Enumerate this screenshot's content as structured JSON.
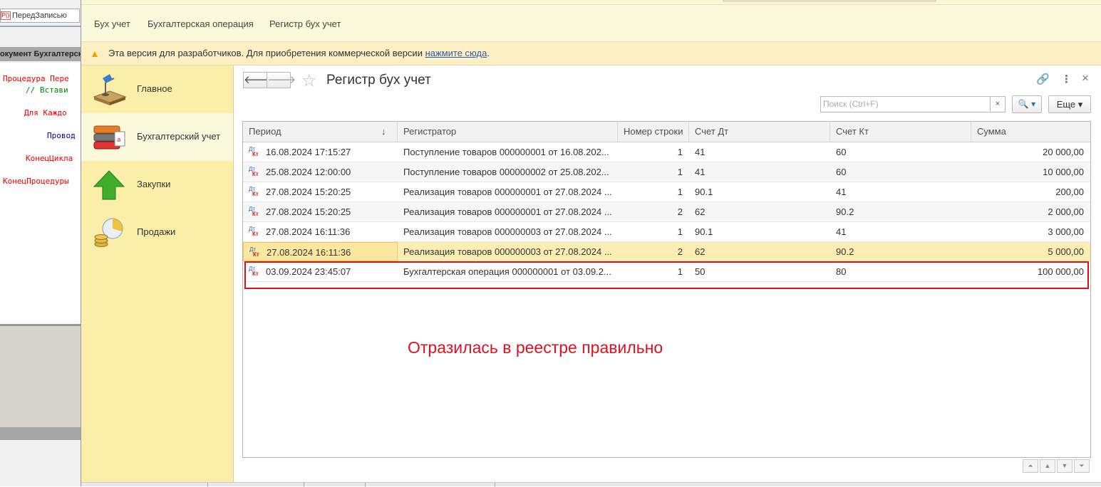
{
  "ide": {
    "procedure_select": "ПередЗаписью",
    "document_header": "окумент Бухгалтерск",
    "code_lines": [
      "Процедура Пере",
      "// Встави",
      "Для Каждо",
      "Провод",
      "КонецЦикла",
      "КонецПроцедуры"
    ]
  },
  "menu": {
    "items": [
      "Бух учет",
      "Бухгалтерская операция",
      "Регистр бух учет"
    ]
  },
  "notice": {
    "text": "Эта версия для разработчиков. Для приобретения коммерческой версии",
    "link": "нажмите сюда",
    "tail": "."
  },
  "sections": {
    "items": [
      {
        "label": "Главное",
        "icon": "desk-lamp-icon"
      },
      {
        "label": "Бухгалтерский учет",
        "icon": "binders-icon"
      },
      {
        "label": "Закупки",
        "icon": "green-arrow-up-icon"
      },
      {
        "label": "Продажи",
        "icon": "coins-chart-icon"
      }
    ],
    "active": "Бухгалтерский учет"
  },
  "form": {
    "back": "🡐",
    "forward": "🡒",
    "title": "Регистр бух учет",
    "search_placeholder": "Поиск (Ctrl+F)",
    "search_clear": "×",
    "search_button": "🔍 ▾",
    "more_button": "Еще ▾",
    "link_icon": "🔗",
    "menu_icon": "⋮",
    "close_icon": "×"
  },
  "table": {
    "columns": [
      "Период",
      "Регистратор",
      "Номер строки",
      "Счет Дт",
      "Счет Кт",
      "Сумма"
    ],
    "sort_indicator": "↓",
    "rows": [
      {
        "period": "16.08.2024 17:15:27",
        "registrar": "Поступление товаров 000000001 от 16.08.202...",
        "line": "1",
        "dt": "41",
        "kt": "60",
        "sum": "20 000,00"
      },
      {
        "period": "25.08.2024 12:00:00",
        "registrar": "Поступление товаров 000000002 от 25.08.202...",
        "line": "1",
        "dt": "41",
        "kt": "60",
        "sum": "10 000,00"
      },
      {
        "period": "27.08.2024 15:20:25",
        "registrar": "Реализация товаров 000000001 от 27.08.2024 ...",
        "line": "1",
        "dt": "90.1",
        "kt": "41",
        "sum": "200,00"
      },
      {
        "period": "27.08.2024 15:20:25",
        "registrar": "Реализация товаров 000000001 от 27.08.2024 ...",
        "line": "2",
        "dt": "62",
        "kt": "90.2",
        "sum": "2 000,00"
      },
      {
        "period": "27.08.2024 16:11:36",
        "registrar": "Реализация товаров 000000003 от 27.08.2024 ...",
        "line": "1",
        "dt": "90.1",
        "kt": "41",
        "sum": "3 000,00"
      },
      {
        "period": "27.08.2024 16:11:36",
        "registrar": "Реализация товаров 000000003 от 27.08.2024 ...",
        "line": "2",
        "dt": "62",
        "kt": "90.2",
        "sum": "5 000,00"
      },
      {
        "period": "03.09.2024 23:45:07",
        "registrar": "Бухгалтерская операция 000000001 от 03.09.2...",
        "line": "1",
        "dt": "50",
        "kt": "80",
        "sum": "100 000,00"
      }
    ],
    "selected_row": 6,
    "row_icon_dt": "Дт",
    "row_icon_kt": "Кт"
  },
  "annotation": "Отразилась в реестре правильно",
  "pager": [
    "⏶",
    "▲",
    "▼",
    "⏷"
  ]
}
